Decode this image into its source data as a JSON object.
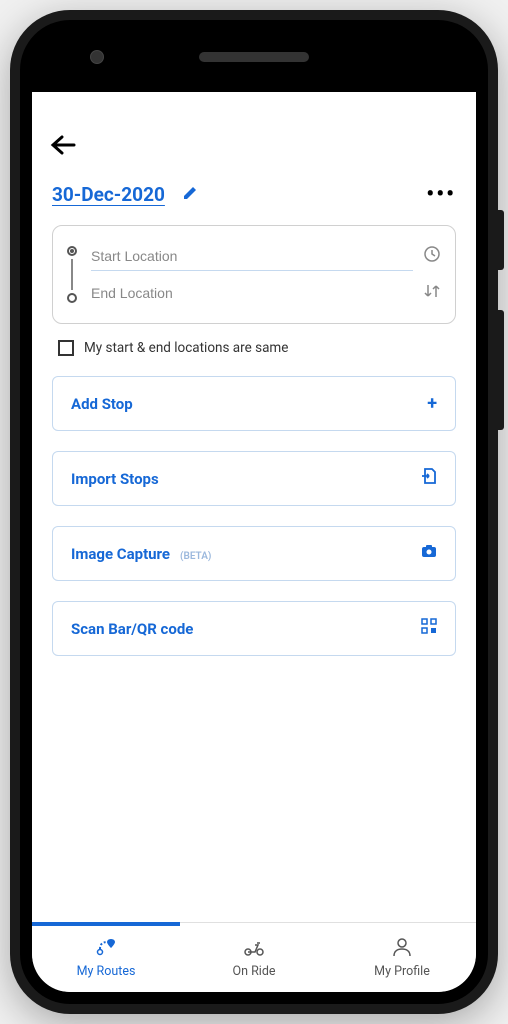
{
  "date": "30-Dec-2020",
  "location": {
    "start_placeholder": "Start Location",
    "end_placeholder": "End Location",
    "start_value": "",
    "end_value": ""
  },
  "same_location_checkbox": {
    "label": "My start & end locations are same",
    "checked": false
  },
  "actions": {
    "add_stop": "Add Stop",
    "import_stops": "Import Stops",
    "image_capture": "Image Capture",
    "image_capture_badge": "(BETA)",
    "scan_code": "Scan Bar/QR code"
  },
  "nav": {
    "my_routes": "My Routes",
    "on_ride": "On Ride",
    "my_profile": "My Profile",
    "active": "my_routes"
  },
  "colors": {
    "primary": "#1668d6"
  }
}
